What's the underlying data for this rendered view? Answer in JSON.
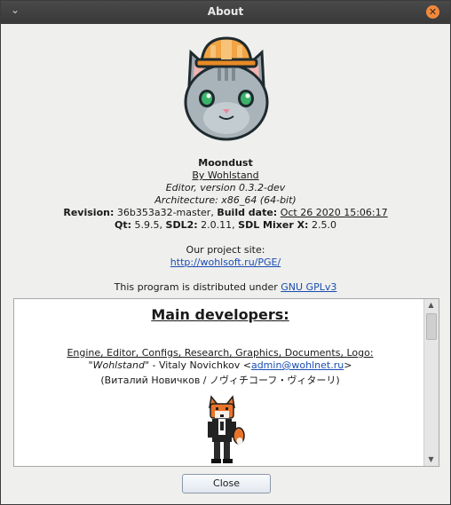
{
  "window": {
    "title": "About",
    "menu_glyph": "⌄",
    "close_glyph": "✕"
  },
  "about": {
    "app_name": "Moondust",
    "by_line": "By Wohlstand",
    "editor_version": "Editor, version 0.3.2-dev",
    "architecture": "Architecture: x86_64 (64-bit)",
    "revision_label": "Revision:",
    "revision_value": "36b353a32-master,",
    "build_date_label": "Build date:",
    "build_date_value": "Oct 26 2020 15:06:17",
    "qt_label": "Qt:",
    "qt_value": "5.9.5,",
    "sdl2_label": "SDL2:",
    "sdl2_value": "2.0.11,",
    "sdl_mixer_label": "SDL Mixer X:",
    "sdl_mixer_value": "2.5.0",
    "site_label": "Our project site:",
    "site_url": "http://wohlsoft.ru/PGE/",
    "license_prefix": "This program is distributed under",
    "license_link": "GNU GPLv3"
  },
  "credits": {
    "heading": "Main developers:",
    "role_line": "Engine, Editor, Configs, Research, Graphics, Documents, Logo:",
    "author_nick": "\"Wohlstand\"",
    "author_name": "- Vitaly Novichkov <",
    "author_email": "admin@wohlnet.ru",
    "author_email_close": ">",
    "author_native": "(Виталий Новичков / ノヴィチコーフ・ヴィターリ)"
  },
  "scrollbar": {
    "up_glyph": "▲",
    "down_glyph": "▼",
    "position": 0
  },
  "buttons": {
    "close_label": "Close"
  },
  "colors": {
    "titlebar": "#3f3f3f",
    "close_button": "#f2883c",
    "link": "#1a4db3"
  }
}
